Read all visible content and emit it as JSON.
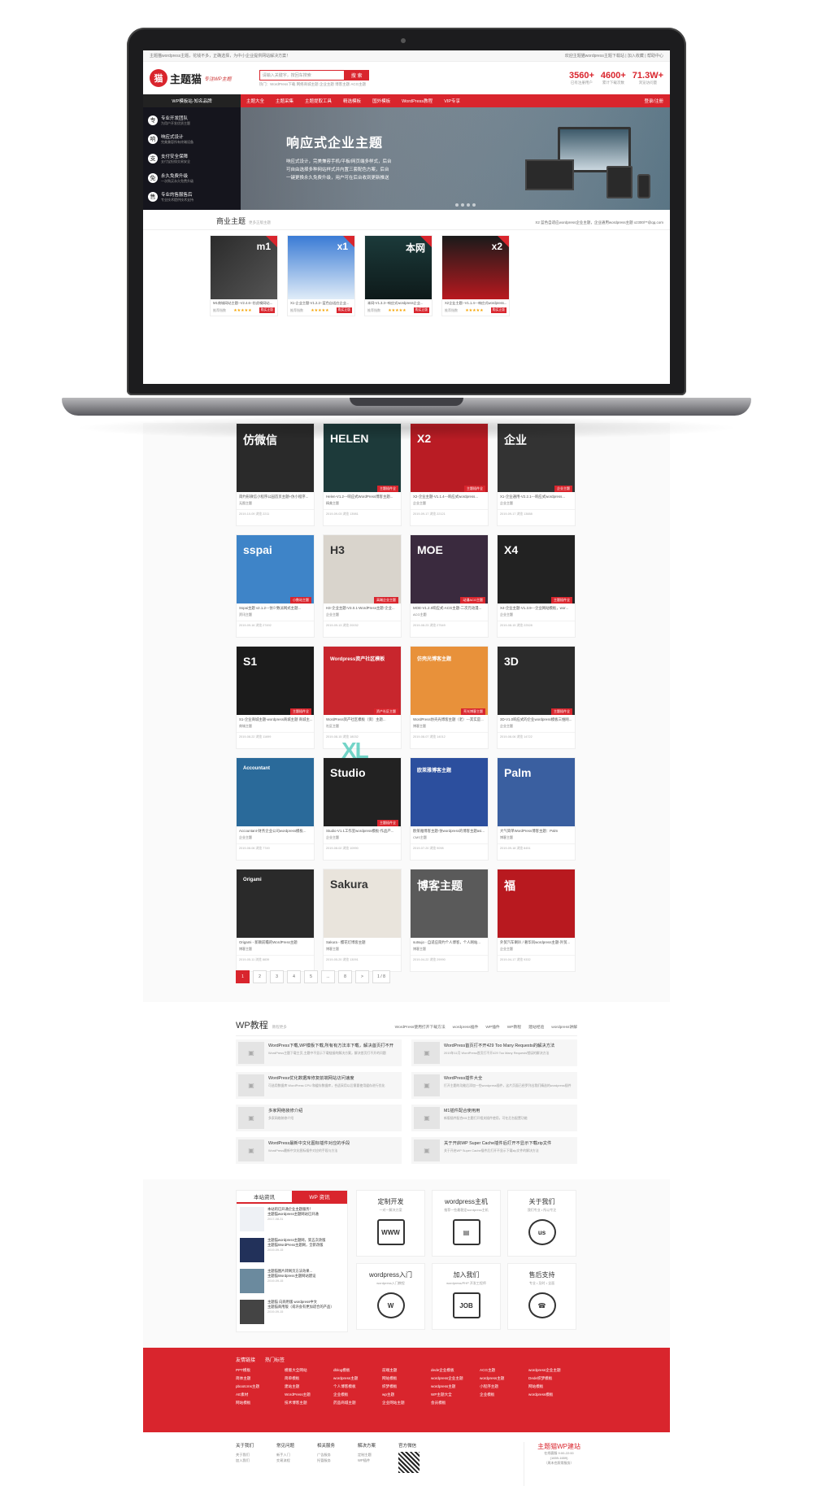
{
  "site": {
    "topbar_left": "主题猫wordpress主题，花钱不多，正确选择，为中小企业提供网站解决方案！",
    "topbar_right": "欢迎主题猫wordpress主题下载站 | 加入收藏 | 帮助中心",
    "logo_mark": "猫",
    "logo_name": "主题猫",
    "slogan": "专注WP主题",
    "search_placeholder": "请输入关键字，按回车搜索",
    "search_button": "搜 索",
    "hotwords": "热门：WordPress下载  网络商城主题  企业主题  博客主题  ACG主题",
    "stats": [
      {
        "num": "3560+",
        "label": "已有注册用户"
      },
      {
        "num": "4600+",
        "label": "累计下载次数"
      },
      {
        "num": "71.3W+",
        "label": "浏览访问量"
      }
    ]
  },
  "nav": {
    "first": "WP模板站-知名品牌",
    "items": [
      "主题大全",
      "主题采集",
      "主题提取工具",
      "精选模板",
      "国外模板",
      "WordPress教程",
      "VIP专享"
    ],
    "login": "登录/注册"
  },
  "banner": {
    "features": [
      {
        "icon": "专",
        "title": "专业开发团队",
        "sub": "为用户开发优质主题"
      },
      {
        "icon": "响",
        "title": "响应式设计",
        "sub": "完美兼容所有终端设备"
      },
      {
        "icon": "支",
        "title": "支付安全保障",
        "sub": "支付宝担保交易安全"
      },
      {
        "icon": "免",
        "title": "永久免费升级",
        "sub": "一次购买永久免费升级"
      },
      {
        "icon": "售",
        "title": "专业的售服售后",
        "sub": "专业技术提供技术支持"
      }
    ],
    "title": "响应式企业主题",
    "desc": "响应式设计，完美兼容手机/平板/网页端多样式，后台可自由选择多种网站样式并内置三套配色方案，后台一键更换永久免费升级，用户可在后台收到更新推送"
  },
  "commercial": {
    "title": "商业主题",
    "sub": "更多正版主题",
    "notice": "X2 蓝色自适应wordpress企业主题，企业通用wordpress主题 xz300/**@qq.com",
    "cards": [
      {
        "title": "M1商城网站主题--V2.4.6--仿虎嗅网站...",
        "source": "推荐指数",
        "stars": "★★★★★",
        "btn": "购买正版",
        "thumb_text": "m1"
      },
      {
        "title": "X1-企业主题-V1.2.2--蓝色自适应企业...",
        "source": "推荐指数",
        "stars": "★★★★★",
        "btn": "购买正版",
        "thumb_text": "x1"
      },
      {
        "title": "本网-V1.3.3--响应式wordpress企业...",
        "source": "推荐指数",
        "stars": "★★★★★",
        "btn": "购买正版",
        "thumb_text": "本网"
      },
      {
        "title": "X2企业主题--V1.1.4---响应式wordpress...",
        "source": "推荐指数",
        "stars": "★★★★★",
        "btn": "购买正版",
        "thumb_text": "x2"
      }
    ]
  },
  "products": [
    {
      "title": "简约形微信小程序公园首页主题+仿小程序...",
      "cat": "无图主题",
      "date": "2019-10-09  浏览 2211",
      "thumb": "仿微信",
      "tag": "",
      "bg": "#2a2a2a"
    },
    {
      "title": "Helen-V1.2---响应式WordPress博客主题...",
      "cat": "精美主题",
      "date": "2019-09-03  浏览 13981",
      "thumb": "HELEN",
      "tag": "主题插件全",
      "bg": "#1d3a3a"
    },
    {
      "title": "X2-企业主题-V1.1.4---响应式wordpress...",
      "cat": "企业主题",
      "date": "2019-09-17  浏览 22121",
      "thumb": "X2",
      "tag": "主题插件全",
      "bg": "#b91c24"
    },
    {
      "title": "X1-企业通用-V2.2.1---响应式wordpress...",
      "cat": "企业主题",
      "date": "2019-09-17  浏览 13888",
      "thumb": "企业",
      "tag": "企业主题",
      "bg": "#333"
    },
    {
      "title": "Sspai主题 v2.1.2---仿少数派网式主题...",
      "cat": "资讯主题",
      "date": "2019-09-16  浏览 27492",
      "thumb": "sspai",
      "tag": "小数站主题",
      "bg": "#3e84c8"
    },
    {
      "title": "H3-企业主题-V3.0.1-WordPress主题-企业...",
      "cat": "企业主题",
      "date": "2019-09-13  浏览 20032",
      "thumb": "H3",
      "tag": "高端企业主题",
      "bg": "#d9d4cc"
    },
    {
      "title": "MOE-V1.2.0响应式-ACG主题-二次元动漫...",
      "cat": "ACG主题",
      "date": "2019-08-23  浏览 27549",
      "thumb": "MOE",
      "tag": "动漫ACG主题",
      "bg": "#3a2a3e"
    },
    {
      "title": "X4-企业主题-V1.3.9---企业网站模板，wor...",
      "cat": "企业主题",
      "date": "2019-08-15  浏览 22528",
      "thumb": "X4",
      "tag": "主题插件全",
      "bg": "#222"
    },
    {
      "title": "S1-企业商城主题-wordpress商城主题 商城主...",
      "cat": "商城主题",
      "date": "2019-08-22  浏览 11699",
      "thumb": "S1",
      "tag": "主题插件全",
      "bg": "#1b1b1b"
    },
    {
      "title": "WordPress资产社区模板（资）主题...",
      "cat": "社区主题",
      "date": "2019-08-15  浏览 18032",
      "thumb": "Wordpress资产社区模板",
      "tag": "资产社区主题",
      "bg": "#c8262d"
    },
    {
      "title": "WordPress仿壳光博客主题（老）---其实是...",
      "cat": "博客主题",
      "date": "2019-08-07  浏览 14012",
      "thumb": "仿壳光博客主题",
      "tag": "壳光博客主题",
      "bg": "#e8913a"
    },
    {
      "title": "3D-V1.0响应式的企业wordpress模板三维网...",
      "cat": "企业主题",
      "date": "2019-08-06  浏览 14722",
      "thumb": "3D",
      "tag": "主题插件全",
      "bg": "#2b2b2b"
    },
    {
      "title": "Accountant-财务企业公司wordpress模板...",
      "cat": "企业主题",
      "date": "2019-08-06  浏览 7749",
      "thumb": "Accountant",
      "tag": "",
      "bg": "#2a6a9a"
    },
    {
      "title": "Studio-V1.1工作室wordpress模板-作品产...",
      "cat": "企业主题",
      "date": "2019-08-02  浏览 10990",
      "thumb": "Studio",
      "tag": "主题插件全",
      "bg": "#222"
    },
    {
      "title": "欧莱雅博客主题-仿wordpress的博客主题asi...",
      "cat": "CMS主题",
      "date": "2019-07-20  浏览 9098",
      "thumb": "欧莱雅博客主题",
      "tag": "",
      "bg": "#2c4f9e"
    },
    {
      "title": "大气简单WordPress博客主题：Palm",
      "cat": "博客主题",
      "date": "2019-09-18  浏览 8451",
      "thumb": "Palm",
      "tag": "",
      "bg": "#3a5fa0"
    },
    {
      "title": "Origami - 新颖前瞻的WordPress主题",
      "cat": "博客主题",
      "date": "2019-05-11  浏览 8839",
      "thumb": "Origami",
      "tag": "",
      "bg": "#2a2a2a"
    },
    {
      "title": "Sakura - 樱花灯博客主题",
      "cat": "博客主题",
      "date": "2019-05-20  浏览 13091",
      "thumb": "Sakura",
      "tag": "",
      "bg": "#e9e4dc"
    },
    {
      "title": "sutsujo - 自适应简约个人博客，个人网站...",
      "cat": "博客主题",
      "date": "2019-04-22  浏览 29990",
      "thumb": "博客主题",
      "tag": "",
      "bg": "#5a5a5a"
    },
    {
      "title": "外贸汽车喇叭 / 奢华风wordpress主题-外贸...",
      "cat": "企业主题",
      "date": "2019-04-17  浏览 9332",
      "thumb": "福",
      "tag": "",
      "bg": "#b8191f"
    }
  ],
  "pager": [
    "1",
    "2",
    "3",
    "4",
    "5",
    "...",
    "8",
    ">",
    "1 / 8"
  ],
  "watermark": "XL",
  "wp_section": {
    "title": "WP教程",
    "sub": "教程更多",
    "tabs": [
      "WordPress使用打开下载方法",
      "wordpress插件",
      "WP插件",
      "WP教程",
      "建站经验",
      "wordpress讲解"
    ],
    "items": [
      {
        "title": "WordPress下载,WP模板下载,所有有方法本下载，解决首页打不开",
        "desc": "WordPress主题下载主页,主题中不显示下载链接的解决方案，解决首页打不开的问题"
      },
      {
        "title": "WordPress首页打不开429 Too Many Requests的解决方法",
        "desc": "2019年11月 WordPress首页打不开429 Too Many Requests错误的解决方法"
      },
      {
        "title": "WordPress优化数据库修复前端网站访问速度",
        "desc": "可选用数据库 WordPress CPU 和缓存数据库，合适采用以后需要使用缓存进行优化"
      },
      {
        "title": "WordPress插件大全",
        "desc": "打开主题的功能后添加一些wordpress插件，这片页面已经罗列出我们精选的wordpress插件"
      },
      {
        "title": "多家网络装修介绍",
        "desc": "多家网络装修介绍"
      },
      {
        "title": "M1插件配合使用用",
        "desc": "新版插件配合M1主题打开相关插件使用，可在后台配置功能"
      },
      {
        "title": "WordPress最新中文化图标插件对应的手段",
        "desc": "WordPress最新中文化图标插件对应的手段与方法"
      },
      {
        "title": "关于开启WP Super Cache插件后打开不显示下载zip文件",
        "desc": "关于开启WP Super Cache插件后打开不显示下载zip文件的解决方法"
      }
    ]
  },
  "news": {
    "tabs": [
      "本站资讯",
      "WP 资讯"
    ],
    "items": [
      {
        "title": "本站的已开通企业主题服务！",
        "desc": "主题猫wordpress主题网站已开通",
        "date": "2017-08-31"
      },
      {
        "title": "主题猫wordpress主题网，第五次改版",
        "desc": "主题猫WordPress主题网，全新改版",
        "date": "2019-09-15"
      },
      {
        "title": "主题猫图片转网页方法效果...",
        "desc": "主题猫Wordpress主题网站建设",
        "date": "2019-09-15"
      },
      {
        "title": "主题猫 向商用版 wordpress中文",
        "desc": "主题猫商用版（或许会有更加适合的产品）",
        "date": "2019-09-15"
      }
    ]
  },
  "services": [
    {
      "title": "定制开发",
      "sub": "一对一解决方案",
      "icon": "WWW"
    },
    {
      "title": "wordpress主机",
      "sub": "推荐一些最稳定wordpress主机",
      "icon": "▤"
    },
    {
      "title": "关于我们",
      "sub": "我们专业 • 所以专注",
      "icon": "us"
    },
    {
      "title": "wordpress入门",
      "sub": "wordpress入门教程",
      "icon": "W"
    },
    {
      "title": "加入我们",
      "sub": "wordpress/PHP 开发工程师",
      "icon": "JOB"
    },
    {
      "title": "售后支持",
      "sub": "专业 • 及时 • 全面",
      "icon": "☎"
    }
  ],
  "friend_links": {
    "head": [
      "友情链接",
      "热门标签"
    ],
    "items": [
      "PPT模板",
      "模版大全网站",
      "dblog模板",
      "前端主题",
      "dede企业模板",
      "ACG主题",
      "wordpress企业主题",
      "简体主题",
      "简单模板",
      "wordpress主题",
      "网站模板",
      "wordpress企业主题",
      "wordpress主题",
      "Dede织梦模板",
      "pbootcms主题",
      "建站主题",
      "个人博客模板",
      "织梦模板",
      "wordpress主题",
      "小程序主题",
      "网站模板",
      "AE素材",
      "WordPress主题",
      "企业模板",
      "wp主题",
      "WP主题大全",
      "企业模板",
      "wordpress模板",
      "网站模板",
      "技术博客主题",
      "药品商城主题",
      "企业网站主题",
      "会员模板",
      "",
      ""
    ]
  },
  "footer": {
    "cols": [
      {
        "title": "关于我们",
        "items": [
          "关于我们",
          "加入我们"
        ]
      },
      {
        "title": "常见问题",
        "items": [
          "新手入门",
          "交易流程"
        ]
      },
      {
        "title": "相关服务",
        "items": [
          "广告服务",
          "托管服务"
        ]
      },
      {
        "title": "解决方案",
        "items": [
          "定制主题",
          "WP插件"
        ]
      },
      {
        "title": "官方微信",
        "items": []
      }
    ],
    "hotline_title": "主题猫WP建站",
    "hotline_lines": [
      "在线客服 9:00-22:00",
      "(1659-1659)",
      "（周末也照常服务）"
    ]
  }
}
